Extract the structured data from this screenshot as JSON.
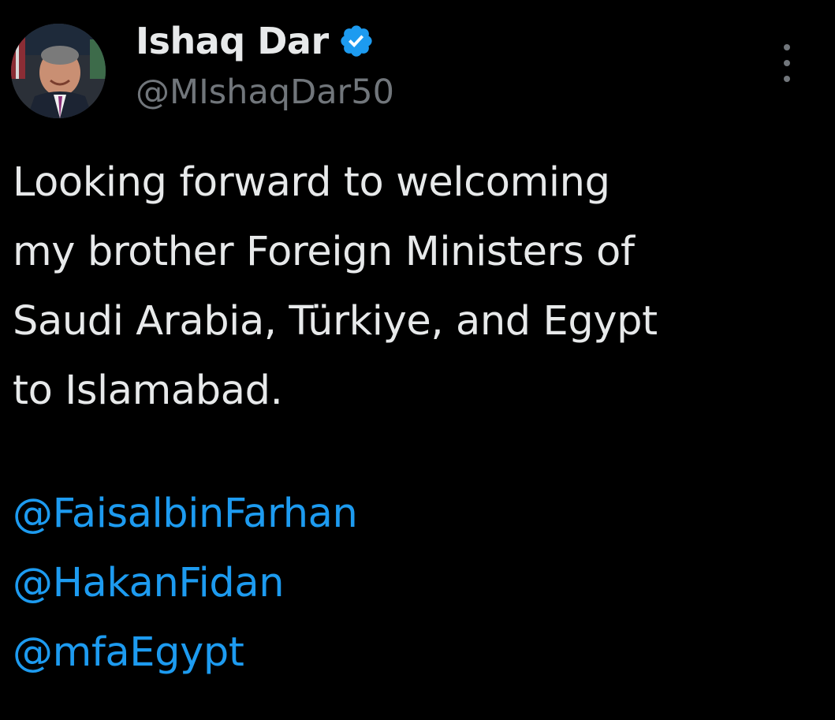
{
  "author": {
    "display_name": "Ishaq Dar",
    "handle": "@MIshaqDar50",
    "verified": true,
    "avatar_icon": "profile-photo",
    "verified_color": "#1d9bf0"
  },
  "tweet": {
    "lines": [
      "Looking forward to welcoming",
      "my brother Foreign Ministers of",
      "Saudi Arabia, Türkiye, and Egypt",
      "to Islamabad."
    ],
    "mentions": [
      "@FaisalbinFarhan",
      "@HakanFidan",
      "@mfaEgypt"
    ]
  },
  "menu": {
    "icon": "more-vertical-icon"
  },
  "colors": {
    "background": "#000000",
    "text": "#e7e9ea",
    "secondary": "#71767b",
    "link": "#1d9bf0"
  }
}
